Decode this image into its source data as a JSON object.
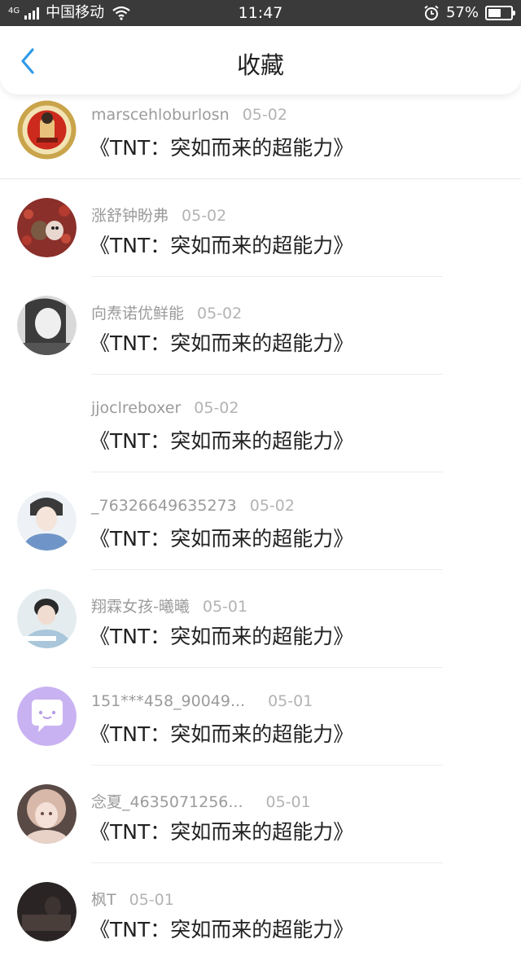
{
  "status_bar": {
    "network": "4G",
    "carrier": "中国移动",
    "time": "11:47",
    "battery": "57%",
    "battery_level": 0.57
  },
  "header": {
    "title": "收藏",
    "back_icon": "chevron-left-icon",
    "accent_color": "#2f9ae8"
  },
  "items": [
    {
      "user": "marscehloburlosn",
      "date": "05-02",
      "title": "《TNT：突如而来的超能力》",
      "avatar": "avatar-red-gold"
    },
    {
      "user": "涨舒钟盼弗",
      "date": "05-02",
      "title": "《TNT：突如而来的超能力》",
      "avatar": "avatar-animals"
    },
    {
      "user": "向焘诺优鲜能",
      "date": "05-02",
      "title": "《TNT：突如而来的超能力》",
      "avatar": "avatar-gray-girl"
    },
    {
      "user": "jjoclreboxer",
      "date": "05-02",
      "title": "《TNT：突如而来的超能力》",
      "avatar": "avatar-none"
    },
    {
      "user": "_76326649635273",
      "date": "05-02",
      "title": "《TNT：突如而来的超能力》",
      "avatar": "avatar-boy-blue"
    },
    {
      "user": "翔霖女孩-曦曦",
      "date": "05-01",
      "title": "《TNT：突如而来的超能力》",
      "avatar": "avatar-boy-desk"
    },
    {
      "user": "151***458_90049...",
      "date": "05-01",
      "title": "《TNT：突如而来的超能力》",
      "avatar": "avatar-purple-chat"
    },
    {
      "user": "念夏_4635071256...",
      "date": "05-01",
      "title": "《TNT：突如而来的超能力》",
      "avatar": "avatar-anime-girl"
    },
    {
      "user": "枫T",
      "date": "05-01",
      "title": "《TNT：突如而来的超能力》",
      "avatar": "avatar-dark"
    }
  ]
}
